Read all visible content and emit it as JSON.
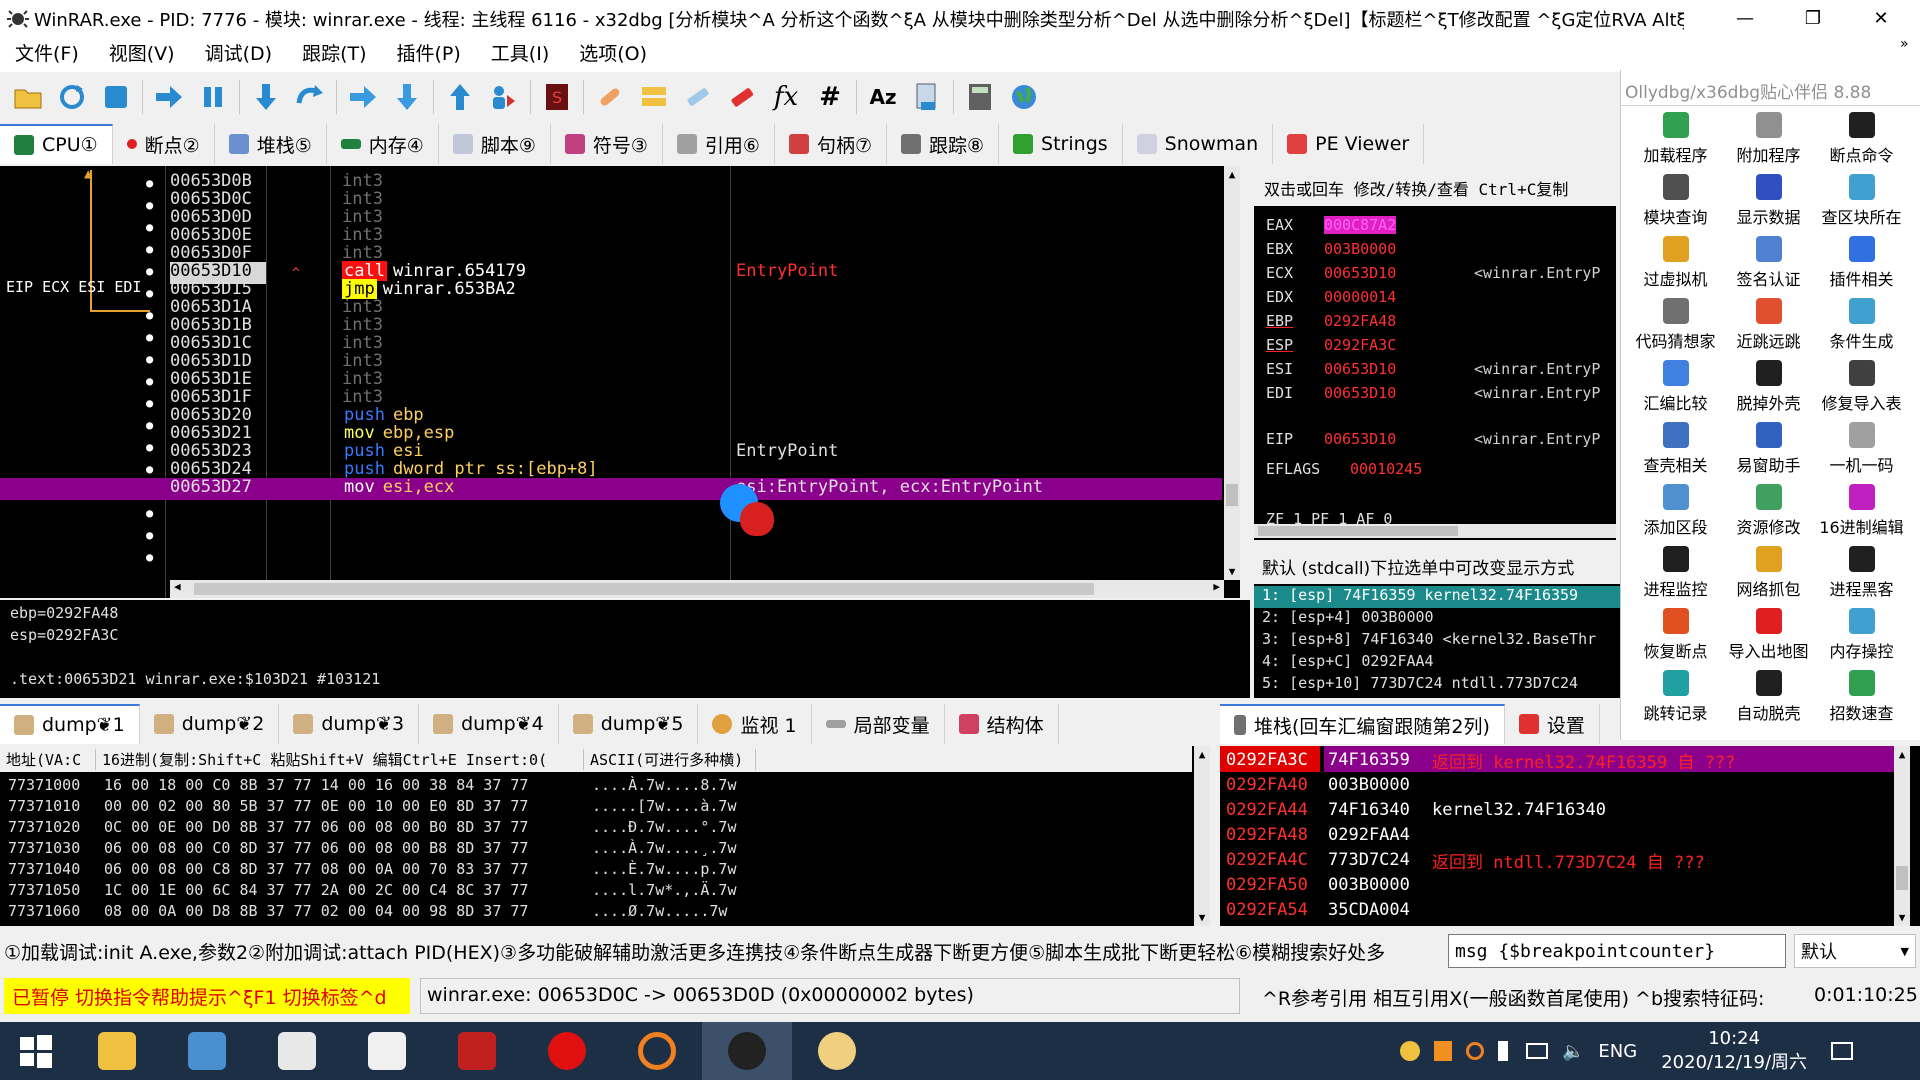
{
  "window": {
    "title": "WinRAR.exe - PID: 7776 - 模块: winrar.exe - 线程: 主线程 6116 - x32dbg [分析模块^A 分析这个函数^ξA 从模块中删除类型分析^Del 从选中删除分析^ξDel]【标题栏^ξT修改配置 ^ξG定位RVA AltξGε..."
  },
  "menu": [
    "文件(F)",
    "视图(V)",
    "调试(D)",
    "跟踪(T)",
    "插件(P)",
    "工具(I)",
    "选项(O)"
  ],
  "toolbar_icons": [
    "open-icon",
    "restart-icon",
    "stop-icon",
    "run-icon",
    "pause-icon",
    "step-into-icon",
    "step-over-icon",
    "trace-into-icon",
    "trace-over-icon",
    "execute-till-return-icon",
    "run-to-user-code-icon",
    "scylla-icon",
    "patch-icon",
    "comment-icon",
    "label-icon",
    "bookmark-icon",
    "function-icon",
    "hash-icon",
    "font-icon",
    "map-icon",
    "calculator-icon",
    "globe-icon"
  ],
  "tabs": [
    "CPU①",
    "断点②",
    "堆栈⑤",
    "内存④",
    "脚本⑨",
    "符号③",
    "引用⑥",
    "句柄⑦",
    "跟踪⑧",
    "Strings",
    "Snowman",
    "PE Viewer"
  ],
  "cpu": {
    "eip_label": "EIP ECX ESI EDI",
    "rows": [
      {
        "addr": "00653D0B",
        "asm": "int3",
        "comment": ""
      },
      {
        "addr": "00653D0C",
        "asm": "int3",
        "comment": ""
      },
      {
        "addr": "00653D0D",
        "asm": "int3",
        "comment": ""
      },
      {
        "addr": "00653D0E",
        "asm": "int3",
        "comment": ""
      },
      {
        "addr": "00653D0F",
        "asm": "int3",
        "comment": ""
      },
      {
        "addr": "00653D10",
        "asm": "winrar.654179",
        "op": "call",
        "comment": "EntryPoint"
      },
      {
        "addr": "00653D15",
        "asm": "winrar.653BA2",
        "op": "jmp",
        "comment": ""
      },
      {
        "addr": "00653D1A",
        "asm": "int3",
        "comment": ""
      },
      {
        "addr": "00653D1B",
        "asm": "int3",
        "comment": ""
      },
      {
        "addr": "00653D1C",
        "asm": "int3",
        "comment": ""
      },
      {
        "addr": "00653D1D",
        "asm": "int3",
        "comment": ""
      },
      {
        "addr": "00653D1E",
        "asm": "int3",
        "comment": ""
      },
      {
        "addr": "00653D1F",
        "asm": "int3",
        "comment": ""
      },
      {
        "addr": "00653D20",
        "asm": "ebp",
        "op": "push",
        "comment": ""
      },
      {
        "addr": "00653D21",
        "asm": "ebp,esp",
        "op": "mov",
        "comment": ""
      },
      {
        "addr": "00653D23",
        "asm": "esi",
        "op": "push",
        "comment": "EntryPoint"
      },
      {
        "addr": "00653D24",
        "asm": "dword ptr ss:[ebp+8]",
        "op": "push",
        "comment": ""
      },
      {
        "addr": "00653D27",
        "asm": "esi,ecx",
        "op": "mov",
        "comment": "esi:EntryPoint, ecx:EntryPoint"
      }
    ]
  },
  "regs_header": "双击或回车 修改/转换/查看 Ctrl+C复制",
  "regs": [
    {
      "name": "EAX",
      "val": "000C87A2",
      "note": ""
    },
    {
      "name": "EBX",
      "val": "003B0000",
      "note": ""
    },
    {
      "name": "ECX",
      "val": "00653D10",
      "note": "<winrar.EntryP"
    },
    {
      "name": "EDX",
      "val": "00000014",
      "note": ""
    },
    {
      "name": "EBP",
      "val": "0292FA48",
      "note": ""
    },
    {
      "name": "ESP",
      "val": "0292FA3C",
      "note": ""
    },
    {
      "name": "ESI",
      "val": "00653D10",
      "note": "<winrar.EntryP"
    },
    {
      "name": "EDI",
      "val": "00653D10",
      "note": "<winrar.EntryP"
    },
    {
      "name": "EIP",
      "val": "00653D10",
      "note": "<winrar.EntryP"
    },
    {
      "name": "EFLAGS",
      "val": "00010245",
      "note": ""
    }
  ],
  "flags_row": "ZF 1  PF 1  AF 0",
  "info": {
    "line1": "ebp=0292FA48",
    "line2": "esp=0292FA3C",
    "line3": ".text:00653D21 winrar.exe:$103D21 #103121"
  },
  "callstack": {
    "header": "默认 (stdcall)下拉选单中可改变显示方式",
    "rows": [
      "1: [esp] 74F16359 kernel32.74F16359",
      "2: [esp+4] 003B0000",
      "3: [esp+8] 74F16340 <kernel32.BaseThr",
      "4: [esp+C] 0292FAA4",
      "5: [esp+10] 773D7C24 ntdll.773D7C24"
    ]
  },
  "dumptabs": [
    "dump❦1",
    "dump❦2",
    "dump❦3",
    "dump❦4",
    "dump❦5",
    "监视 1",
    "局部变量",
    "结构体"
  ],
  "stacktab": "堆栈(回车汇编窗跟随第2列)",
  "stacktab2": "设置",
  "dump": {
    "headers": [
      "地址(VA:C",
      "16进制(复制:Shift+C 粘贴Shift+V 编辑Ctrl+E Insert:0(",
      "ASCII(可进行多种横)"
    ],
    "rows": [
      {
        "addr": "77371000",
        "hex": "16 00 18 00 C0 8B 37 77 14 00 16 00 38 84 37 77",
        "ascii": "....À.7w....8.7w"
      },
      {
        "addr": "77371010",
        "hex": "00 00 02 00 80 5B 37 77 0E 00 10 00 E0 8D 37 77",
        "ascii": ".....[7w....à.7w"
      },
      {
        "addr": "77371020",
        "hex": "0C 00 0E 00 D0 8B 37 77 06 00 08 00 B0 8D 37 77",
        "ascii": "....Ð.7w....°.7w"
      },
      {
        "addr": "77371030",
        "hex": "06 00 08 00 C0 8D 37 77 06 00 08 00 B8 8D 37 77",
        "ascii": "....À.7w....¸.7w"
      },
      {
        "addr": "77371040",
        "hex": "06 00 08 00 C8 8D 37 77 08 00 0A 00 70 83 37 77",
        "ascii": "....È.7w....p.7w"
      },
      {
        "addr": "77371050",
        "hex": "1C 00 1E 00 6C 84 37 77 2A 00 2C 00 C4 8C 37 77",
        "ascii": "....l.7w*.,.Ä.7w"
      },
      {
        "addr": "77371060",
        "hex": "08 00 0A 00 D8 8B 37 77 02 00 04 00 98 8D 37 77",
        "ascii": "....Ø.7w.....7w"
      }
    ]
  },
  "stack": {
    "rows": [
      {
        "addr": "0292FA3C",
        "val": "74F16359",
        "note": "返回到 kernel32.74F16359 自 ???"
      },
      {
        "addr": "0292FA40",
        "val": "003B0000",
        "note": ""
      },
      {
        "addr": "0292FA44",
        "val": "74F16340",
        "note": "kernel32.74F16340"
      },
      {
        "addr": "0292FA48",
        "val": "0292FAA4",
        "note": ""
      },
      {
        "addr": "0292FA4C",
        "val": "773D7C24",
        "note": "返回到 ntdll.773D7C24 自 ???"
      },
      {
        "addr": "0292FA50",
        "val": "003B0000",
        "note": ""
      },
      {
        "addr": "0292FA54",
        "val": "35CDA004",
        "note": ""
      }
    ]
  },
  "sidebar": {
    "title": "Ollydbg/x36dbg贴心伴侣 8.88",
    "items": [
      "加载程序",
      "附加程序",
      "断点命令",
      "模块查询",
      "显示数据",
      "查区块所在",
      "过虚拟机",
      "签名认证",
      "插件相关",
      "代码猜想家",
      "近跳远跳",
      "条件生成",
      "汇编比较",
      "脱掉外壳",
      "修复导入表",
      "查壳相关",
      "易窗助手",
      "一机一码",
      "添加区段",
      "资源修改",
      "16进制编辑",
      "进程监控",
      "网络抓包",
      "进程黑客",
      "恢复断点",
      "导入出地图",
      "内存操控",
      "跳转记录",
      "自动脱壳",
      "招数速查"
    ]
  },
  "cmdbar": {
    "hint": "①加载调试:init A.exe,参数2②附加调试:attach PID(HEX)③多功能破解辅助激活更多连携技④条件断点生成器下断更方便⑤脚本生成批下断更轻松⑥模糊搜索好处多",
    "input": "msg {$breakpointcounter}",
    "mode": "默认"
  },
  "status": {
    "paused": "已暂停 切换指令帮助提示^ξF1 切换标签^d",
    "main": "winrar.exe: 00653D0C -> 00653D0D (0x00000002 bytes)",
    "right": "^R参考引用  相互引用X(一般函数首尾使用) ^b搜索特征码:",
    "time": "0:01:10:25"
  },
  "taskbar": {
    "lang": "ENG",
    "time": "10:24",
    "date": "2020/12/19/周六"
  },
  "colors": {
    "accent": "#3c78d8",
    "highlight": "#8b008b",
    "reg_red": "#ff3030",
    "status_yellow": "#ffff00"
  }
}
